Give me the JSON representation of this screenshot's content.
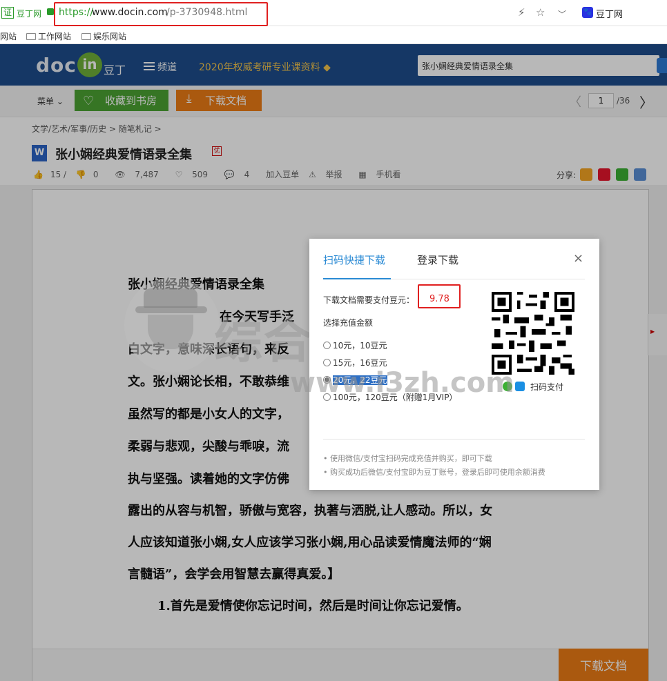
{
  "browser": {
    "cert_badge": "证",
    "site_label": "豆丁网",
    "url_scheme": "https://",
    "url_host": "www.docin.com",
    "url_path": "/p-3730948.html",
    "search_engine_label": "豆丁网"
  },
  "bookmarks": [
    "网站",
    "工作网站",
    "娱乐网站"
  ],
  "header": {
    "logo_doc": "doc",
    "logo_in": "in",
    "logo_cn": "豆丁",
    "nav_channel": "频道",
    "promo": "2020年权威考研专业课资料 ◆",
    "search_value": "张小娴经典爱情语录全集"
  },
  "toolbar": {
    "menu_label": "菜单 ⌄",
    "fav_label": "收藏到书房",
    "download_label": "下载文档",
    "page_current": "1",
    "page_total": "/36"
  },
  "breadcrumb": "文学/艺术/军事/历史 > 随笔札记 >",
  "doc": {
    "title": "张小娴经典爱情语录全集",
    "vip": "优",
    "likes": "15 / ",
    "dislikes": "0",
    "views": "7,487",
    "favorites": "509",
    "comments": "4",
    "add_list": "加入豆单",
    "report": "举报",
    "mobile": "手机看",
    "share_label": "分享:"
  },
  "content": {
    "lines": [
      "张小娴经典爱情语录全集",
      "在今天写手泛",
      "白文字，意味深长语句，来反",
      "文。张小娴论长相，不敢恭维",
      "虽然写的都是小女人的文字，",
      "柔弱与悲观，尖酸与乖唳，流",
      "执与坚强。读着她的文字仿佛",
      "露出的从容与机智，骄傲与宽容，执著与洒脱,让人感动。所以，女",
      "人应该知道张小娴,女人应该学习张小娴,用心品读爱情魔法师的“娴",
      "言髓语”，会学会用智慧去赢得真爱。】",
      "1.首先是爱情使你忘记时间，然后是时间让你忘记爱情。"
    ],
    "footer_download": "下载文档"
  },
  "watermark": {
    "text": "综合社区",
    "url": "www.i3zh.com"
  },
  "modal": {
    "tab_scan": "扫码快捷下载",
    "tab_login": "登录下载",
    "close": "×",
    "price_label": "下载文档需要支付豆元：",
    "price_value": "9.78",
    "amount_label": "选择充值金额",
    "options": [
      "10元，10豆元",
      "15元，16豆元",
      "20元，22豆元",
      "100元，120豆元（附赠1月VIP）"
    ],
    "selected_option": 2,
    "pay_label": "扫码支付",
    "notes": [
      "• 使用微信/支付宝扫码完成充值并购买，即可下载",
      "• 购买成功后微信/支付宝即为豆丁账号，登录后即可使用余额消费"
    ]
  },
  "colors": {
    "header_bg": "#1e4d8c",
    "accent_green": "#4ca233",
    "accent_orange": "#ec7c16",
    "link_blue": "#2a8ad4",
    "alert_red": "#e02020"
  }
}
